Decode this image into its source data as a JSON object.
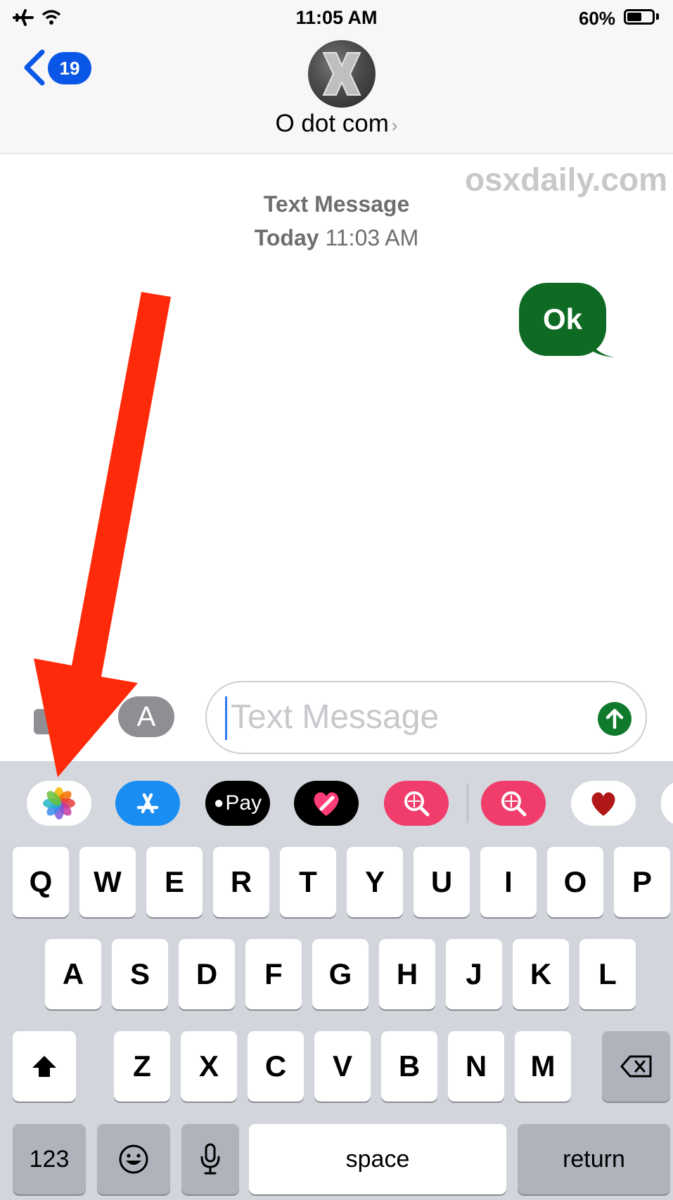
{
  "status_bar": {
    "time": "11:05 AM",
    "battery_percent": "60%",
    "battery_level": 0.6
  },
  "header": {
    "back_count": "19",
    "contact_name": "O dot com"
  },
  "watermark": "osxdaily.com",
  "conversation": {
    "service_label": "Text Message",
    "day": "Today",
    "time": "11:03 AM",
    "messages": [
      {
        "text": "Ok",
        "direction": "outgoing"
      }
    ]
  },
  "composer": {
    "placeholder": "Text Message"
  },
  "app_drawer": {
    "items": [
      {
        "name": "photos-app-icon"
      },
      {
        "name": "app-store-icon"
      },
      {
        "name": "apple-pay-icon",
        "label": "Pay"
      },
      {
        "name": "digital-touch-icon"
      },
      {
        "name": "images-search-icon"
      },
      {
        "name": "images-search-icon-2"
      },
      {
        "name": "heart-sticker-icon"
      }
    ]
  },
  "keyboard": {
    "row1": [
      "Q",
      "W",
      "E",
      "R",
      "T",
      "Y",
      "U",
      "I",
      "O",
      "P"
    ],
    "row2": [
      "A",
      "S",
      "D",
      "F",
      "G",
      "H",
      "J",
      "K",
      "L"
    ],
    "row3": [
      "Z",
      "X",
      "C",
      "V",
      "B",
      "N",
      "M"
    ],
    "numbers_label": "123",
    "space_label": "space",
    "return_label": "return"
  },
  "colors": {
    "sent_bubble": "#0f6b24",
    "badge_blue": "#0a56e6",
    "annotation_arrow": "#ff2a0a",
    "send_button": "#0f7a2c"
  }
}
